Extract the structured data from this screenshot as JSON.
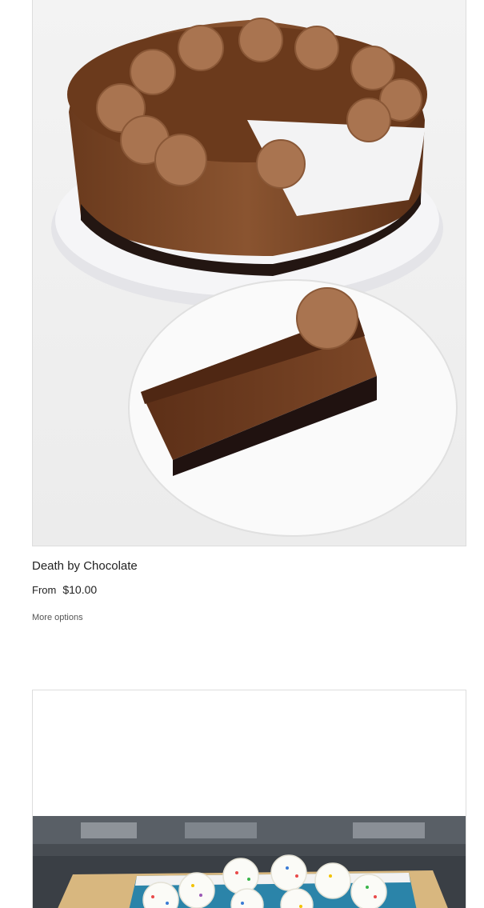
{
  "products": [
    {
      "title": "Death by Chocolate",
      "price_prefix": "From",
      "price": "$10.00",
      "action_label": "More options",
      "image": "chocolate-cheesecake-image"
    },
    {
      "image": "sprinkle-cake-image"
    }
  ]
}
